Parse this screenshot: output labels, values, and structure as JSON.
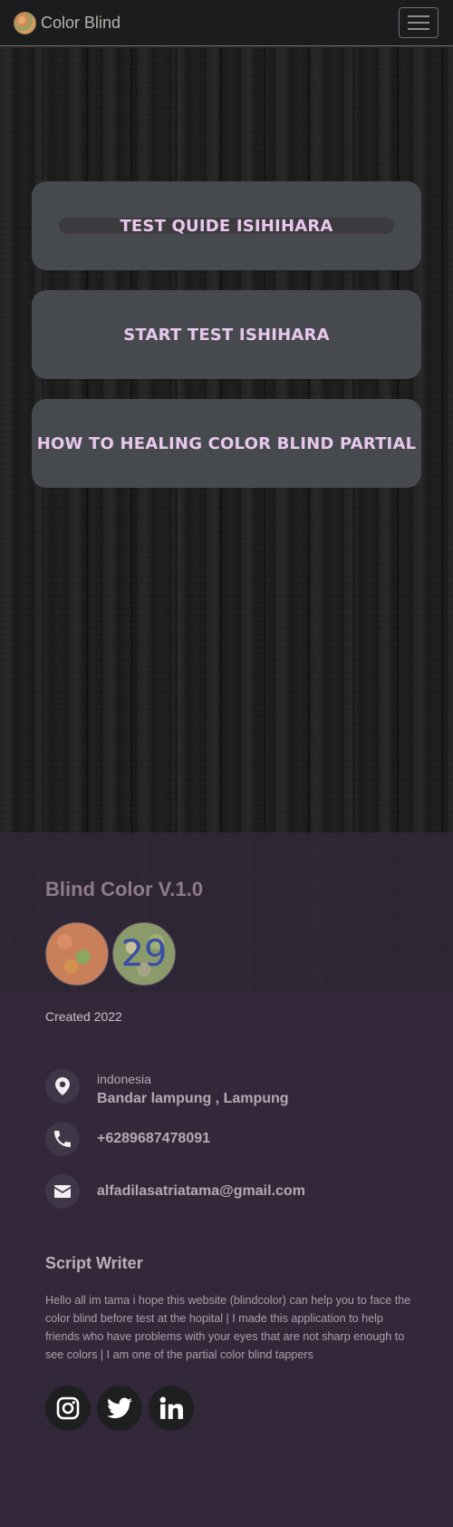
{
  "navbar": {
    "brand": "Color Blind",
    "logo_icon": "ishihara-plate-icon",
    "menu_icon": "hamburger-menu-icon"
  },
  "menu": {
    "buttons": [
      {
        "label": "TEST QUIDE ISIHIHARA"
      },
      {
        "label": "START TEST ISHIHARA"
      },
      {
        "label": "HOW TO HEALING COLOR BLIND PARTIAL"
      }
    ]
  },
  "footer": {
    "title": "Blind Color V.1.0",
    "plate_number": "29",
    "created": "Created 2022",
    "location": {
      "country": "indonesia",
      "city": "Bandar lampung , Lampung",
      "icon": "location-pin-icon"
    },
    "phone": {
      "value": "+6289687478091",
      "icon": "phone-icon"
    },
    "email": {
      "value": "alfadilasatriatama@gmail.com",
      "icon": "envelope-icon"
    },
    "script_title": "Script Writer",
    "script_text": "Hello all im tama i hope this website (blindcolor) can help you to face the color blind before test at the hopital | I made this application to help friends who have problems with your eyes that are not sharp enough to see colors | I am one of the partial color blind tappers",
    "socials": [
      {
        "name": "instagram",
        "icon": "instagram-icon"
      },
      {
        "name": "twitter",
        "icon": "twitter-icon"
      },
      {
        "name": "linkedin",
        "icon": "linkedin-icon"
      }
    ]
  },
  "colors": {
    "accent_text": "#e8c8ec",
    "footer_bg": "#32283a",
    "button_bg": "#464a4e"
  }
}
